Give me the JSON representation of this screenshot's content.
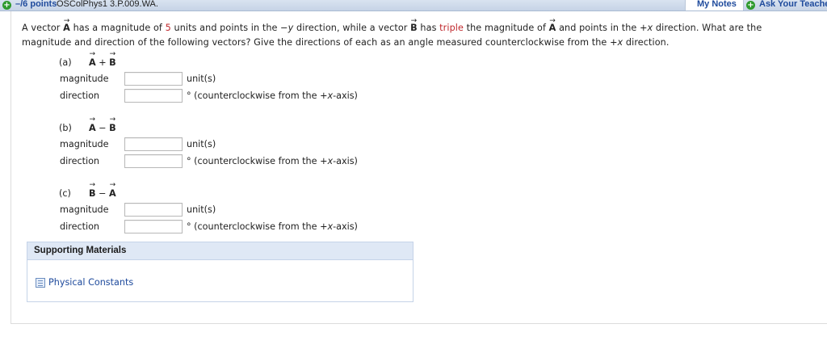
{
  "header": {
    "points": "–/6 points",
    "problem_id": "OSColPhys1 3.P.009.WA.",
    "my_notes": "My Notes",
    "ask_teacher": "Ask Your Teache"
  },
  "question": {
    "t1": "A vector ",
    "vecA": "A",
    "t2": " has a magnitude of ",
    "mag": "5",
    "t3": " units and points in the −",
    "y": "y",
    "t4": " direction, while a vector ",
    "vecB": "B",
    "t5": " has ",
    "triple": "triple",
    "t6": " the magnitude of ",
    "vecA2": "A",
    "t7": " and points in the +",
    "x1": "x",
    "t8": " direction. What are the magnitude and direction of the following vectors? Give the directions of each as an angle measured counterclockwise from the +",
    "x2": "x",
    "t9": " direction."
  },
  "parts": [
    {
      "label": "(a)",
      "v1": "A",
      "op": "+",
      "v2": "B"
    },
    {
      "label": "(b)",
      "v1": "A",
      "op": "−",
      "v2": "B"
    },
    {
      "label": "(c)",
      "v1": "B",
      "op": "−",
      "v2": "A"
    }
  ],
  "rows": {
    "magnitude_label": "magnitude",
    "direction_label": "direction",
    "unit_text": "unit(s)",
    "dir_unit_prefix": "° (counterclockwise from the +",
    "dir_unit_x": "x",
    "dir_unit_suffix": "-axis)"
  },
  "support": {
    "title": "Supporting Materials",
    "link": "Physical Constants"
  },
  "colors": {
    "accent": "#1e4a9c",
    "highlight": "#c0282d",
    "header_bg": "#d3deec",
    "support_bg": "#dfe8f5"
  }
}
